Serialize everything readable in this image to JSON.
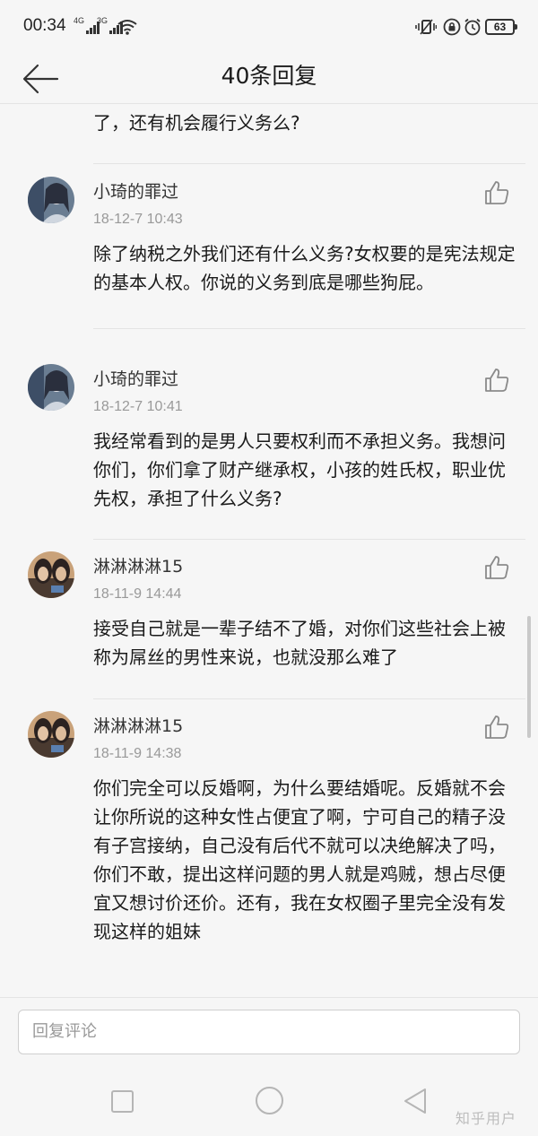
{
  "status_bar": {
    "time": "00:34",
    "signal_1": "4G",
    "signal_2": "3G",
    "battery": "63"
  },
  "header": {
    "title": "40条回复"
  },
  "feed": {
    "partial_previous": "了，还有机会履行义务么?",
    "comments": [
      {
        "author": "小琦的罪过",
        "time": "18-12-7 10:43",
        "body": "除了纳税之外我们还有什么义务?女权要的是宪法规定的基本人权。你说的义务到底是哪些狗屁。"
      },
      {
        "author": "小琦的罪过",
        "time": "18-12-7 10:41",
        "body": "我经常看到的是男人只要权利而不承担义务。我想问你们，你们拿了财产继承权，小孩的姓氏权，职业优先权，承担了什么义务?"
      },
      {
        "author": "淋淋淋淋15",
        "time": "18-11-9 14:44",
        "body": "接受自己就是一辈子结不了婚，对你们这些社会上被称为屌丝的男性来说，也就没那么难了"
      },
      {
        "author": "淋淋淋淋15",
        "time": "18-11-9 14:38",
        "body": "你们完全可以反婚啊，为什么要结婚呢。反婚就不会让你所说的这种女性占便宜了啊，宁可自己的精子没有子宫接纳，自己没有后代不就可以决绝解决了吗，你们不敢，提出这样问题的男人就是鸡贼，想占尽便宜又想讨价还价。还有，我在女权圈子里完全没有发现这样的姐妹"
      }
    ]
  },
  "reply": {
    "placeholder": "回复评论"
  },
  "watermark": "知乎用户"
}
